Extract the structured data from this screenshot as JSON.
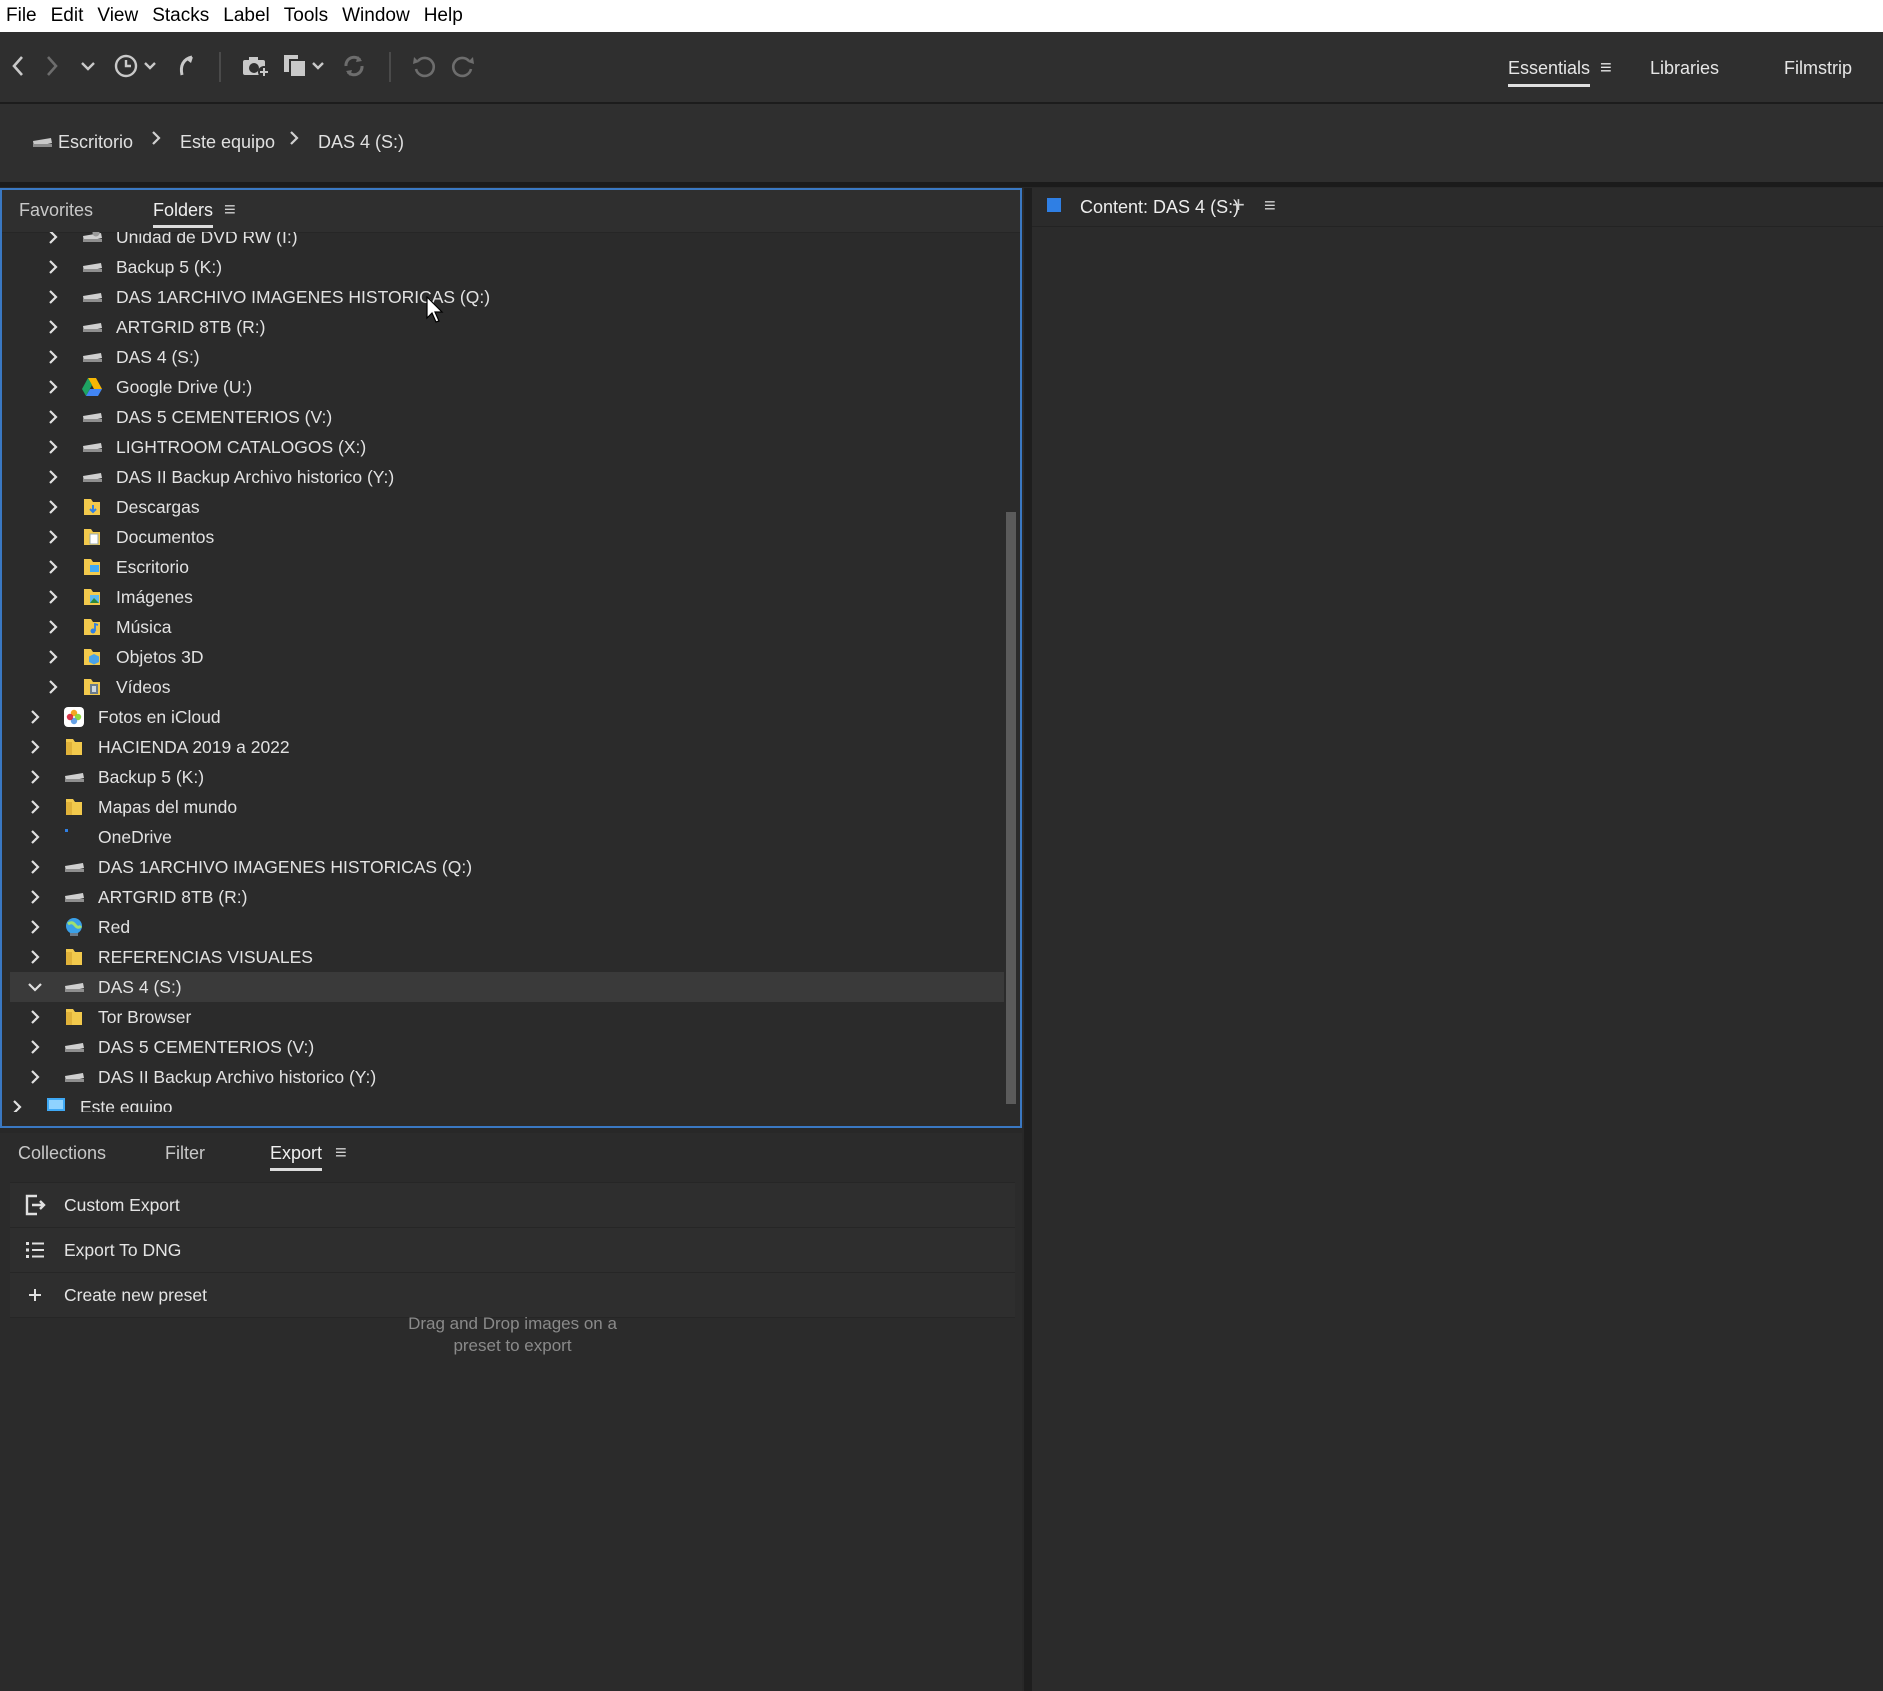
{
  "menubar": {
    "items": [
      "File",
      "Edit",
      "View",
      "Stacks",
      "Label",
      "Tools",
      "Window",
      "Help"
    ]
  },
  "workspaces": {
    "essentials": "Essentials",
    "libraries": "Libraries",
    "filmstrip": "Filmstrip"
  },
  "breadcrumb": [
    "Escritorio",
    "Este equipo",
    "DAS 4 (S:)"
  ],
  "folders_panel": {
    "tabs": {
      "favorites": "Favorites",
      "folders": "Folders"
    },
    "rows": [
      {
        "label": "Unidad de DVD RW (I:)",
        "icon": "dvd-drive-icon"
      },
      {
        "label": "Backup 5 (K:)",
        "icon": "drive-icon"
      },
      {
        "label": "DAS 1ARCHIVO IMAGENES HISTORICAS (Q:)",
        "icon": "drive-icon"
      },
      {
        "label": "ARTGRID 8TB (R:)",
        "icon": "drive-icon"
      },
      {
        "label": "DAS 4 (S:)",
        "icon": "drive-icon"
      },
      {
        "label": "Google Drive (U:)",
        "icon": "google-drive-icon"
      },
      {
        "label": "DAS 5 CEMENTERIOS (V:)",
        "icon": "drive-icon"
      },
      {
        "label": "LIGHTROOM CATALOGOS (X:)",
        "icon": "drive-icon"
      },
      {
        "label": "DAS II Backup Archivo historico (Y:)",
        "icon": "drive-icon"
      },
      {
        "label": "Descargas",
        "icon": "downloads-folder-icon"
      },
      {
        "label": "Documentos",
        "icon": "documents-folder-icon"
      },
      {
        "label": "Escritorio",
        "icon": "desktop-folder-icon"
      },
      {
        "label": "Imágenes",
        "icon": "pictures-folder-icon"
      },
      {
        "label": "Música",
        "icon": "music-folder-icon"
      },
      {
        "label": "Objetos 3D",
        "icon": "3d-objects-folder-icon"
      },
      {
        "label": "Vídeos",
        "icon": "videos-folder-icon"
      },
      {
        "label": "Fotos en iCloud",
        "icon": "icloud-photos-icon"
      },
      {
        "label": "HACIENDA 2019 a 2022",
        "icon": "folder-icon"
      },
      {
        "label": "Backup 5 (K:)",
        "icon": "drive-icon"
      },
      {
        "label": "Mapas del mundo",
        "icon": "folder-icon"
      },
      {
        "label": "OneDrive",
        "icon": "onedrive-icon"
      },
      {
        "label": "DAS 1ARCHIVO IMAGENES HISTORICAS (Q:)",
        "icon": "drive-icon"
      },
      {
        "label": "ARTGRID 8TB (R:)",
        "icon": "drive-icon"
      },
      {
        "label": "Red",
        "icon": "network-icon"
      },
      {
        "label": "REFERENCIAS VISUALES",
        "icon": "folder-icon"
      },
      {
        "label": "DAS 4 (S:)",
        "icon": "drive-icon",
        "expanded": true,
        "selected": true
      },
      {
        "label": "Tor Browser",
        "icon": "folder-icon"
      },
      {
        "label": "DAS 5 CEMENTERIOS (V:)",
        "icon": "drive-icon"
      },
      {
        "label": "DAS II Backup Archivo historico (Y:)",
        "icon": "drive-icon"
      },
      {
        "label": "Este equipo",
        "icon": "this-pc-icon"
      }
    ]
  },
  "export_panel": {
    "tabs": {
      "collections": "Collections",
      "filter": "Filter",
      "export": "Export"
    },
    "presets": [
      {
        "label": "Custom Export",
        "icon": "export-icon"
      },
      {
        "label": "Export To DNG",
        "icon": "list-icon"
      },
      {
        "label": "Create new preset",
        "icon": "plus-icon"
      }
    ],
    "drop_hint_line1": "Drag and Drop images on a",
    "drop_hint_line2": "preset to export"
  },
  "content_panel": {
    "title": "Content: DAS 4 (S:)"
  },
  "colors": {
    "accent": "#2f7fe4",
    "panel_focus_border": "#3a78c2",
    "background": "#2b2b2b"
  }
}
